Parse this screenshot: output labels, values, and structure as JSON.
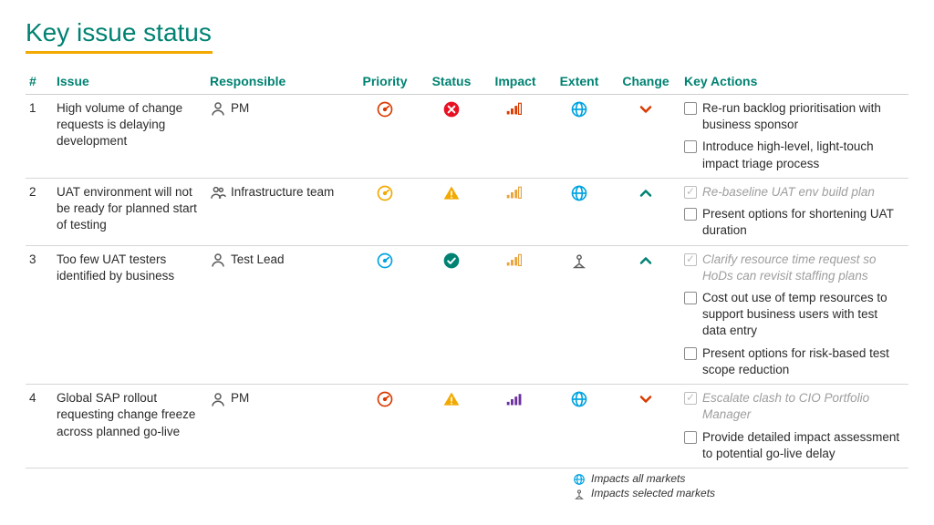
{
  "title": "Key issue status",
  "columns": [
    "#",
    "Issue",
    "Responsible",
    "Priority",
    "Status",
    "Impact",
    "Extent",
    "Change",
    "Key Actions"
  ],
  "colors": {
    "teal": "#008272",
    "amber": "#f2a900",
    "red": "#d83b01",
    "red_bright": "#e81123",
    "blue": "#00a3e0",
    "purple": "#6b2fa0",
    "orange": "#e8a33d",
    "grey": "#5e5e5e"
  },
  "rows": [
    {
      "num": "1",
      "issue": "High volume of change requests is delaying development",
      "responsible": {
        "icon": "person",
        "label": "PM"
      },
      "priority": {
        "icon": "gauge",
        "color": "red"
      },
      "status": {
        "icon": "circle-x",
        "color": "red_bright"
      },
      "impact": {
        "icon": "bars-partial",
        "color": "red"
      },
      "extent": {
        "icon": "globe",
        "color": "blue"
      },
      "change": {
        "icon": "chevron-down",
        "color": "red"
      },
      "actions": [
        {
          "done": false,
          "text": "Re-run backlog prioritisation with business sponsor"
        },
        {
          "done": false,
          "text": "Introduce high-level, light-touch impact triage process"
        }
      ]
    },
    {
      "num": "2",
      "issue": "UAT environment will not be ready for planned start of testing",
      "responsible": {
        "icon": "group",
        "label": "Infrastructure team"
      },
      "priority": {
        "icon": "gauge",
        "color": "amber"
      },
      "status": {
        "icon": "triangle-excl",
        "color": "amber"
      },
      "impact": {
        "icon": "bars-partial",
        "color": "orange"
      },
      "extent": {
        "icon": "globe",
        "color": "blue"
      },
      "change": {
        "icon": "chevron-up",
        "color": "teal"
      },
      "actions": [
        {
          "done": true,
          "text": "Re-baseline UAT env build plan"
        },
        {
          "done": false,
          "text": "Present options for shortening UAT duration"
        }
      ]
    },
    {
      "num": "3",
      "issue": "Too few UAT testers identified by business",
      "responsible": {
        "icon": "person",
        "label": "Test Lead"
      },
      "priority": {
        "icon": "gauge",
        "color": "blue"
      },
      "status": {
        "icon": "circle-check",
        "color": "teal"
      },
      "impact": {
        "icon": "bars-partial",
        "color": "orange"
      },
      "extent": {
        "icon": "map-pin",
        "color": "grey"
      },
      "change": {
        "icon": "chevron-up",
        "color": "teal"
      },
      "actions": [
        {
          "done": true,
          "text": "Clarify resource time request so HoDs can revisit staffing plans"
        },
        {
          "done": false,
          "text": "Cost out use of temp resources to support business users with test data entry"
        },
        {
          "done": false,
          "text": "Present options for risk-based test scope reduction"
        }
      ]
    },
    {
      "num": "4",
      "issue": "Global SAP rollout requesting change freeze across planned go-live",
      "responsible": {
        "icon": "person",
        "label": "PM"
      },
      "priority": {
        "icon": "gauge",
        "color": "red"
      },
      "status": {
        "icon": "triangle-excl",
        "color": "amber"
      },
      "impact": {
        "icon": "bars-full",
        "color": "purple"
      },
      "extent": {
        "icon": "globe",
        "color": "blue"
      },
      "change": {
        "icon": "chevron-down",
        "color": "red"
      },
      "actions": [
        {
          "done": true,
          "text": "Escalate clash to CIO Portfolio Manager"
        },
        {
          "done": false,
          "text": "Provide detailed impact assessment to potential go-live delay"
        }
      ]
    }
  ],
  "legend": [
    {
      "icon": "globe",
      "color": "blue",
      "text": "Impacts all markets"
    },
    {
      "icon": "map-pin",
      "color": "grey",
      "text": "Impacts selected markets"
    }
  ]
}
